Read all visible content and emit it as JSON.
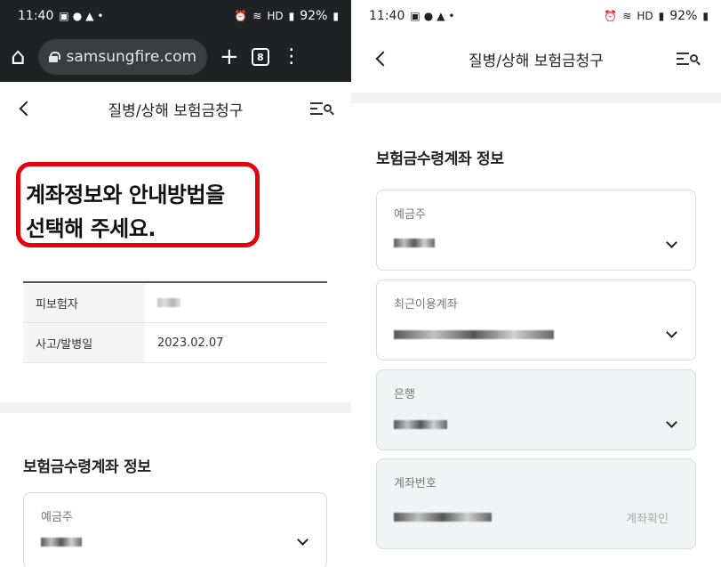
{
  "status_bar": {
    "time": "11:40",
    "battery": "92%",
    "network": "HD"
  },
  "browser": {
    "url": "samsungfire.com",
    "tab_count": "8"
  },
  "app": {
    "title": "질병/상해 보험금청구"
  },
  "left": {
    "headline_line1": "계좌정보와 안내방법을",
    "headline_line2": "선택해 주세요.",
    "info_rows": [
      {
        "label": "피보험자",
        "value": ""
      },
      {
        "label": "사고/발병일",
        "value": "2023.02.07"
      }
    ],
    "section_title": "보험금수령계좌 정보",
    "account_holder_label": "예금주"
  },
  "right": {
    "section_title": "보험금수령계좌 정보",
    "fields": [
      {
        "label": "예금주",
        "type": "select"
      },
      {
        "label": "최근이용계좌",
        "type": "select"
      },
      {
        "label": "은행",
        "type": "select"
      },
      {
        "label": "계좌번호",
        "type": "input",
        "action": "계좌확인"
      }
    ]
  },
  "colors": {
    "highlight_border": "#e3000f",
    "browser_bar": "#1f2124"
  }
}
